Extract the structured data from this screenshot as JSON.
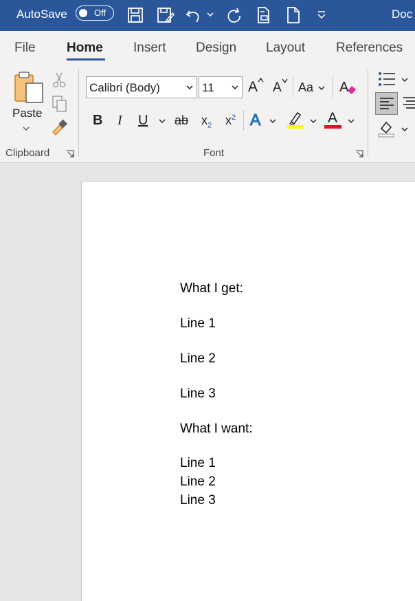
{
  "titlebar": {
    "autosave_label": "AutoSave",
    "autosave_state": "Off",
    "doc_title": "Doc"
  },
  "tabs": [
    {
      "label": "File"
    },
    {
      "label": "Home"
    },
    {
      "label": "Insert"
    },
    {
      "label": "Design"
    },
    {
      "label": "Layout"
    },
    {
      "label": "References"
    }
  ],
  "ribbon": {
    "clipboard": {
      "paste_label": "Paste",
      "group_label": "Clipboard"
    },
    "font": {
      "font_name": "Calibri (Body)",
      "font_size": "11",
      "change_case_label": "Aa",
      "bold": "B",
      "italic": "I",
      "underline": "U",
      "strikethrough": "ab",
      "subscript": "x",
      "subscript_mark": "2",
      "superscript": "x",
      "superscript_mark": "2",
      "grow_font": "A",
      "shrink_font": "A",
      "text_effects": "A",
      "font_color": "A",
      "group_label": "Font",
      "highlight_color": "#ffff00",
      "font_color_value": "#e81123"
    }
  },
  "document": {
    "lines": [
      "What I get:",
      "Line 1",
      "Line 2",
      "Line 3",
      "What I want:",
      "Line 1",
      "Line 2",
      "Line 3"
    ]
  }
}
